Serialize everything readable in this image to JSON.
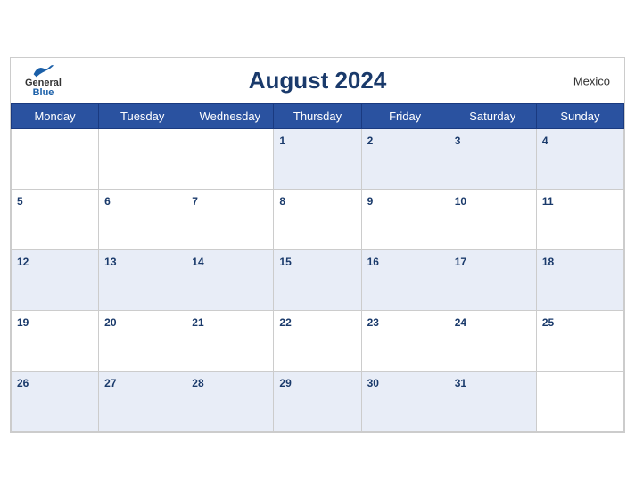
{
  "header": {
    "title": "August 2024",
    "country": "Mexico",
    "logo": {
      "general": "General",
      "blue": "Blue"
    }
  },
  "weekdays": [
    "Monday",
    "Tuesday",
    "Wednesday",
    "Thursday",
    "Friday",
    "Saturday",
    "Sunday"
  ],
  "weeks": [
    [
      null,
      null,
      null,
      1,
      2,
      3,
      4
    ],
    [
      5,
      6,
      7,
      8,
      9,
      10,
      11
    ],
    [
      12,
      13,
      14,
      15,
      16,
      17,
      18
    ],
    [
      19,
      20,
      21,
      22,
      23,
      24,
      25
    ],
    [
      26,
      27,
      28,
      29,
      30,
      31,
      null
    ]
  ]
}
